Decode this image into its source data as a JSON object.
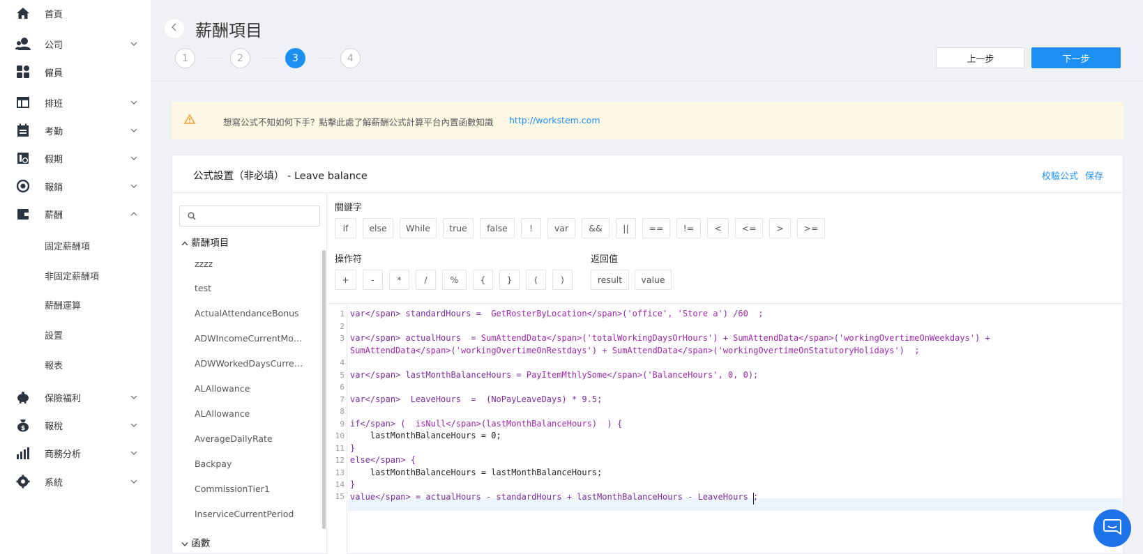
{
  "sidebar": {
    "items": [
      {
        "label": "首頁",
        "icon": "home-icon"
      },
      {
        "label": "公司",
        "icon": "company-icon"
      },
      {
        "label": "僱員",
        "icon": "employee-icon"
      },
      {
        "label": "排班",
        "icon": "schedule-icon"
      },
      {
        "label": "考勤",
        "icon": "attendance-icon"
      },
      {
        "label": "假期",
        "icon": "leave-icon"
      },
      {
        "label": "報銷",
        "icon": "reimburse-icon"
      },
      {
        "label": "薪酬",
        "icon": "wallet-icon"
      },
      {
        "label": "保險福利",
        "icon": "piggy-bank-icon"
      },
      {
        "label": "報稅",
        "icon": "tax-bag-icon"
      },
      {
        "label": "商務分析",
        "icon": "bar-chart-icon"
      },
      {
        "label": "系統",
        "icon": "settings-icon"
      }
    ],
    "payroll_sub": [
      "固定薪酬項",
      "非固定薪酬項",
      "薪酬運算",
      "設置",
      "報表"
    ]
  },
  "header": {
    "title": "薪酬項目",
    "steps": [
      "1",
      "2",
      "3",
      "4"
    ],
    "active_step": 3,
    "prev_label": "上一步",
    "next_label": "下一步"
  },
  "notice": {
    "text": "想寫公式不知如何下手？點擊此處了解薪酬公式計算平台內置函數知識",
    "link": "http://workstem.com"
  },
  "card": {
    "title": "公式設置（非必填） - Leave balance",
    "validate_label": "校驗公式",
    "save_label": "保存"
  },
  "left": {
    "search_placeholder": "",
    "group1": "薪酬項目",
    "items": [
      "zzzz",
      "test",
      "ActualAttendanceBonus",
      "ADWIncomeCurrentMonth",
      "ADWWorkedDaysCurrentMonth",
      "ALAllowance",
      "ALAllowance",
      "AverageDailyRate",
      "Backpay",
      "CommissionTier1",
      "InserviceCurrentPeriod"
    ],
    "group2": "函數"
  },
  "keywords": {
    "label": "關鍵字",
    "items": [
      "if",
      "else",
      "While",
      "true",
      "false",
      "!",
      "var",
      "&&",
      "||",
      "==",
      "!=",
      "<",
      "<=",
      ">",
      ">="
    ]
  },
  "operators": {
    "label": "操作符",
    "items": [
      "+",
      "-",
      "*",
      "/",
      "%",
      "{",
      "}",
      "(",
      ")"
    ]
  },
  "returns": {
    "label": "返回值",
    "items": [
      "result",
      "value"
    ]
  },
  "code": {
    "line_numbers": [
      "1",
      "2",
      "3",
      "",
      "4",
      "5",
      "6",
      "7",
      "8",
      "9",
      "10",
      "11",
      "12",
      "13",
      "14",
      "15"
    ],
    "lines": [
      "var standardHours =  GetRosterByLocation('office', 'Store a') /60  ;",
      "",
      "var actualHours  = SumAttendData('totalWorkingDaysOrHours') + SumAttendData('workingOvertimeOnWeekdays') +",
      "SumAttendData('workingOvertimeOnRestdays') + SumAttendData('workingOvertimeOnStatutoryHolidays')  ;",
      "",
      "var lastMonthBalanceHours = PayItemMthlySome('BalanceHours', 0, 0);",
      "",
      "var  LeaveHours  =  (NoPayLeaveDays) * 9.5;",
      "",
      "if (  isNull(lastMonthBalanceHours)  ) {",
      "    lastMonthBalanceHours = 0;",
      "}",
      "else {",
      "    lastMonthBalanceHours = lastMonthBalanceHours;",
      "}",
      "value = actualHours - standardHours + lastMonthBalanceHours - LeaveHours ;"
    ]
  },
  "colors": {
    "primary": "#1e8ff2",
    "notice_bg": "#fdf8e4",
    "keyword": "#7a2c9c",
    "chat": "#1e73e8"
  }
}
